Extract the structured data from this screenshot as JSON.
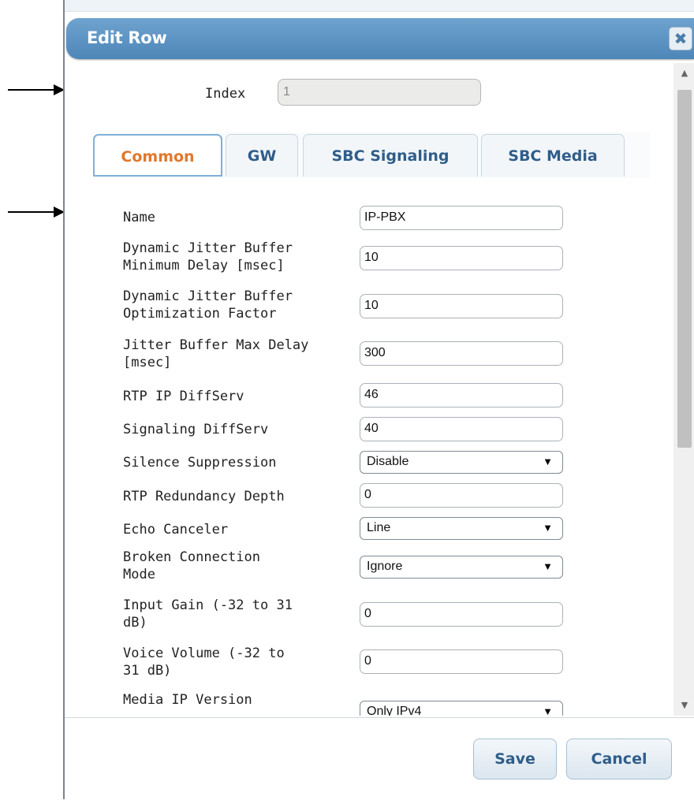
{
  "dialog": {
    "title": "Edit Row",
    "close_glyph": "✖",
    "close_icon": "close-icon"
  },
  "index": {
    "label": "Index",
    "value": "1"
  },
  "tabs": [
    {
      "label": "Common",
      "active": true
    },
    {
      "label": "GW",
      "active": false
    },
    {
      "label": "SBC Signaling",
      "active": false
    },
    {
      "label": "SBC Media",
      "active": false
    }
  ],
  "fields": {
    "name": {
      "label": "Name",
      "value": "IP-PBX"
    },
    "djb_min_delay": {
      "label_line1": "Dynamic Jitter Buffer",
      "label_line2": "Minimum Delay [msec]",
      "value": "10"
    },
    "djb_opt_factor": {
      "label_line1": "Dynamic Jitter Buffer",
      "label_line2": "Optimization Factor",
      "value": "10"
    },
    "jb_max_delay": {
      "label_line1": "Jitter Buffer Max Delay",
      "label_line2": "[msec]",
      "value": "300"
    },
    "rtp_diffserv": {
      "label": "RTP IP DiffServ",
      "value": "46"
    },
    "sig_diffserv": {
      "label": "Signaling DiffServ",
      "value": "40"
    },
    "silence_suppression": {
      "label": "Silence Suppression",
      "value": "Disable"
    },
    "rtp_redundancy": {
      "label": "RTP Redundancy Depth",
      "value": "0"
    },
    "echo_canceler": {
      "label": "Echo Canceler",
      "value": "Line"
    },
    "broken_conn": {
      "label_line1": "Broken Connection",
      "label_line2": "Mode",
      "value": "Ignore"
    },
    "input_gain": {
      "label_line1": "Input Gain (-32 to 31",
      "label_line2": "dB)",
      "value": "0"
    },
    "voice_volume": {
      "label_line1": "Voice Volume (-32 to",
      "label_line2": "31 dB)",
      "value": "0"
    },
    "media_ip_version": {
      "label": "Media IP Version",
      "value": "Only IPv4"
    }
  },
  "dropdown_caret": "▼",
  "scrollbar": {
    "up_glyph": "▲",
    "down_glyph": "▼"
  },
  "footer": {
    "save_label": "Save",
    "cancel_label": "Cancel"
  }
}
